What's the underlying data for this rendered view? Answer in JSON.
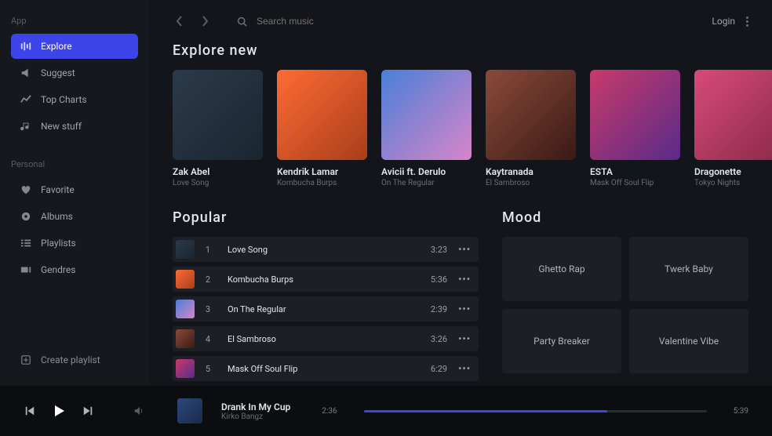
{
  "sidebar": {
    "section_app": "App",
    "section_personal": "Personal",
    "app_items": [
      {
        "label": "Explore",
        "icon": "explore"
      },
      {
        "label": "Suggest",
        "icon": "suggest"
      },
      {
        "label": "Top Charts",
        "icon": "charts"
      },
      {
        "label": "New stuff",
        "icon": "music"
      }
    ],
    "personal_items": [
      {
        "label": "Favorite",
        "icon": "heart"
      },
      {
        "label": "Albums",
        "icon": "disc"
      },
      {
        "label": "Playlists",
        "icon": "list"
      },
      {
        "label": "Gendres",
        "icon": "tag"
      }
    ],
    "create_playlist": "Create playlist"
  },
  "topbar": {
    "search_placeholder": "Search music",
    "login_label": "Login"
  },
  "explore": {
    "heading": "Explore new",
    "cards": [
      {
        "artist": "Zak Abel",
        "track": "Love Song"
      },
      {
        "artist": "Kendrik Lamar",
        "track": "Kombucha Burps"
      },
      {
        "artist": "Avicii ft. Derulo",
        "track": "On The Regular"
      },
      {
        "artist": "Kaytranada",
        "track": "El Sambroso"
      },
      {
        "artist": "ESTA",
        "track": "Mask Off Soul Flip"
      },
      {
        "artist": "Dragonette",
        "track": "Tokyo Nights"
      }
    ]
  },
  "popular": {
    "heading": "Popular",
    "tracks": [
      {
        "num": "1",
        "title": "Love Song",
        "dur": "3:23"
      },
      {
        "num": "2",
        "title": "Kombucha Burps",
        "dur": "5:36"
      },
      {
        "num": "3",
        "title": "On The Regular",
        "dur": "2:39"
      },
      {
        "num": "4",
        "title": "El Sambroso",
        "dur": "3:26"
      },
      {
        "num": "5",
        "title": "Mask Off Soul Flip",
        "dur": "6:29"
      }
    ]
  },
  "mood": {
    "heading": "Mood",
    "cells": [
      "Ghetto Rap",
      "Twerk Baby",
      "Party Breaker",
      "Valentine Vibe"
    ]
  },
  "player": {
    "title": "Drank In My Cup",
    "artist": "Kirko Bangz",
    "elapsed": "2:36",
    "total": "5:39"
  }
}
